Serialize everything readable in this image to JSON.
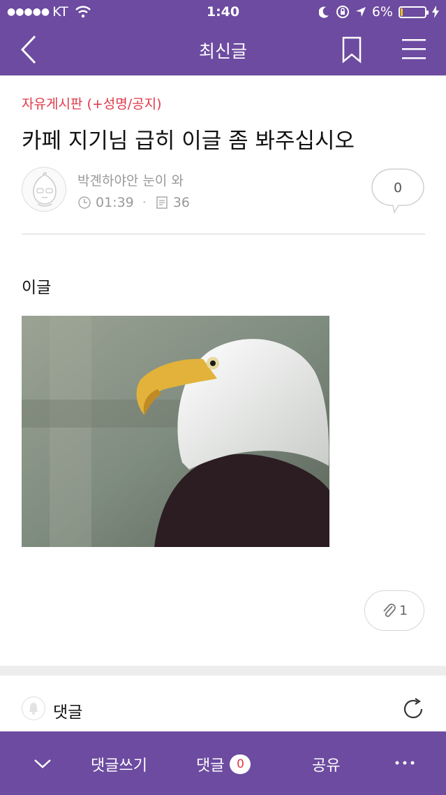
{
  "status_bar": {
    "signal_dots": "●●●●●",
    "carrier": "KT",
    "time": "1:40",
    "battery_percent": "6%",
    "battery_level": 0.06,
    "icons": [
      "wifi-icon",
      "moon-icon",
      "rotation-lock-icon",
      "location-arrow-icon",
      "battery-icon",
      "charging-bolt-icon"
    ]
  },
  "nav": {
    "title": "최신글",
    "icons": [
      "back-chevron-icon",
      "bookmark-icon",
      "hamburger-menu-icon"
    ]
  },
  "post": {
    "category": "자유게시판 (+성명/공지)",
    "title": "카페 지기님 급히 이글 좀 봐주십시오",
    "author": "박곈하야안 눈이 와",
    "time": "01:39",
    "views": "36",
    "comment_count": "0",
    "body_text": "이글",
    "attachment_count": "1"
  },
  "comments": {
    "label": "댓글"
  },
  "toolbar": {
    "write_label": "댓글쓰기",
    "comments_label": "댓글",
    "comments_badge": "0",
    "share_label": "공유"
  },
  "colors": {
    "brand_purple": "#6c4ba0",
    "category_red": "#e0394a",
    "battery_yellow": "#f5c518"
  }
}
